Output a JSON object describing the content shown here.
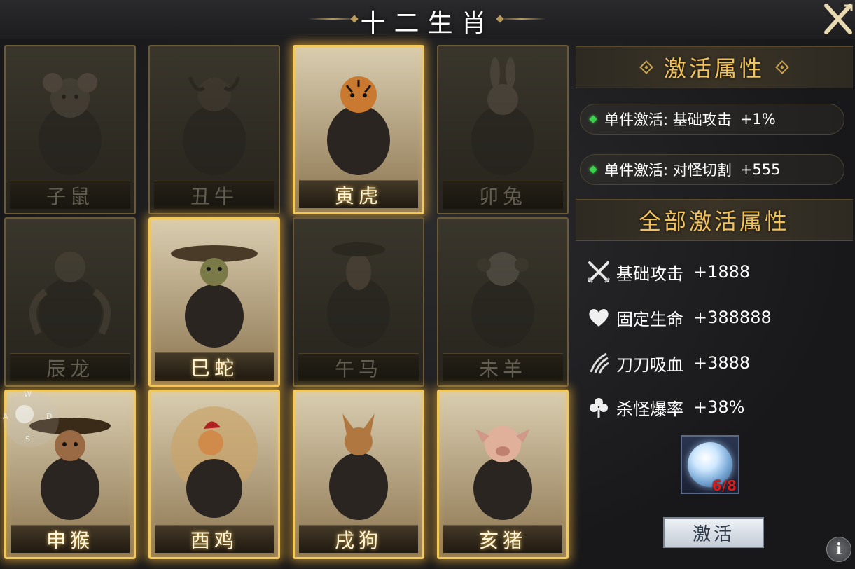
{
  "window": {
    "title": "十二生肖"
  },
  "icons": {
    "close": "close-x-icon",
    "info": "info-icon",
    "attack": "crossed-swords-icon",
    "life": "heart-icon",
    "lifesteal": "claw-slash-icon",
    "droprate": "clover-icon"
  },
  "zodiac": [
    {
      "name": "子鼠",
      "active": false
    },
    {
      "name": "丑牛",
      "active": false
    },
    {
      "name": "寅虎",
      "active": true
    },
    {
      "name": "卯兔",
      "active": false
    },
    {
      "name": "辰龙",
      "active": false
    },
    {
      "name": "巳蛇",
      "active": true
    },
    {
      "name": "午马",
      "active": false
    },
    {
      "name": "未羊",
      "active": false
    },
    {
      "name": "申猴",
      "active": true
    },
    {
      "name": "酉鸡",
      "active": true
    },
    {
      "name": "戌狗",
      "active": true
    },
    {
      "name": "亥猪",
      "active": true
    }
  ],
  "panel": {
    "activate_header": "激活属性",
    "single": [
      {
        "label": "单件激活: 基础攻击",
        "value": "+1%"
      },
      {
        "label": "单件激活: 对怪切割",
        "value": "+555"
      }
    ],
    "all_header": "全部激活属性",
    "attributes": [
      {
        "name": "基础攻击",
        "value": "+1888"
      },
      {
        "name": "固定生命",
        "value": "+388888"
      },
      {
        "name": "刀刀吸血",
        "value": "+3888"
      },
      {
        "name": "杀怪爆率",
        "value": "+38%"
      }
    ],
    "gem_count": "6/8",
    "activate_button": "激活",
    "info_label": "i"
  },
  "joystick": {
    "w": "W",
    "a": "A",
    "s": "S",
    "d": "D"
  },
  "colors": {
    "gold": "#f2c15a",
    "active_border": "#f3c85a",
    "green_dot": "#3ad24a",
    "count_red": "#d61c1c"
  }
}
